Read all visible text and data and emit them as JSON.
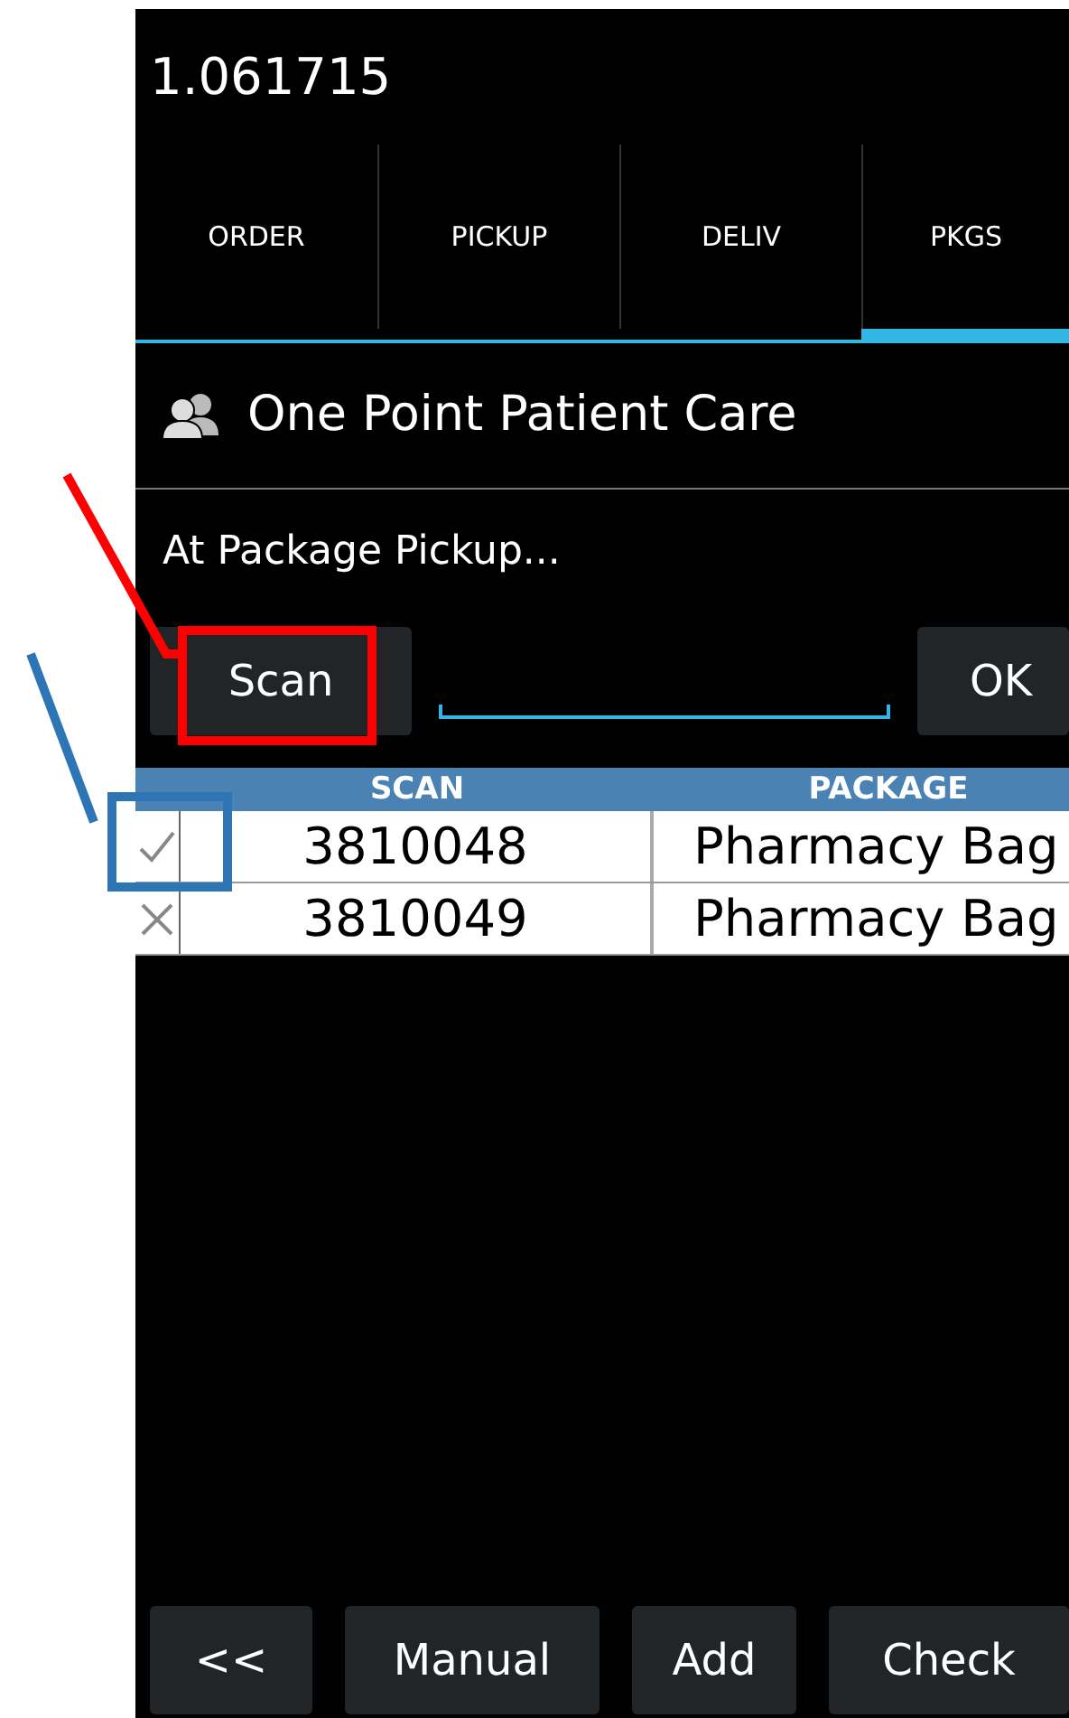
{
  "app_bar": {
    "title": "1.061715"
  },
  "tabs": [
    {
      "label": "ORDER",
      "selected": false
    },
    {
      "label": "PICKUP",
      "selected": false
    },
    {
      "label": "DELIV",
      "selected": false
    },
    {
      "label": "PKGS",
      "selected": true
    }
  ],
  "header": {
    "title": "One Point Patient Care"
  },
  "status_text": "At Package Pickup...",
  "scan_row": {
    "scan_button": "Scan",
    "ok_button": "OK"
  },
  "table": {
    "columns": [
      "SCAN",
      "PACKAGE"
    ],
    "rows": [
      {
        "checked": true,
        "scan": "3810048",
        "package": "Pharmacy Bag"
      },
      {
        "checked": false,
        "scan": "3810049",
        "package": "Pharmacy Bag"
      }
    ]
  },
  "bottom_buttons": [
    "<<",
    "Manual",
    "Add",
    "Check"
  ],
  "annotations": [
    {
      "kind": "callout",
      "color": "#ff0000"
    },
    {
      "kind": "callout",
      "color": "#2e75b6"
    }
  ]
}
